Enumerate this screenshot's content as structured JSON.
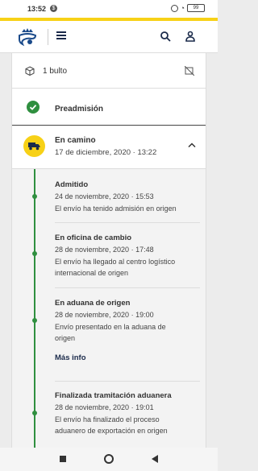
{
  "status_bar": {
    "time": "13:52",
    "notification_icon": "dollar-badge-icon",
    "battery": "99"
  },
  "colors": {
    "brand_yellow": "#f7d117",
    "brand_navy": "#1a2a4a",
    "success_green": "#2f8f3f"
  },
  "header": {
    "logo_icon": "correos-horn-crown-logo",
    "menu_icon": "hamburger-icon",
    "search_icon": "search-icon",
    "user_icon": "user-icon"
  },
  "package": {
    "count_label": "1 bulto"
  },
  "steps": {
    "preadmision": {
      "label": "Preadmisión",
      "status": "completed"
    },
    "en_camino": {
      "label": "En camino",
      "date": "17 de diciembre, 2020 · 13:22",
      "expanded": true
    }
  },
  "events": [
    {
      "title": "Admitido",
      "date": "24 de noviembre, 2020 · 15:53",
      "lines": [
        "El envío ha tenido admisión en origen"
      ]
    },
    {
      "title": "En oficina de cambio",
      "date": "28 de noviembre, 2020 · 17:48",
      "lines": [
        "El envío ha llegado al centro logístico",
        "internacional de origen"
      ]
    },
    {
      "title": "En aduana de origen",
      "date": "28 de noviembre, 2020 · 19:00",
      "lines": [
        "Envío presentado en la aduana de",
        "origen"
      ],
      "more": "Más info"
    },
    {
      "title": "Finalizada tramitación aduanera",
      "date": "28 de noviembre, 2020 · 19:01",
      "lines": [
        "El envío ha finalizado el proceso",
        "aduanero de exportación en origen"
      ]
    }
  ]
}
